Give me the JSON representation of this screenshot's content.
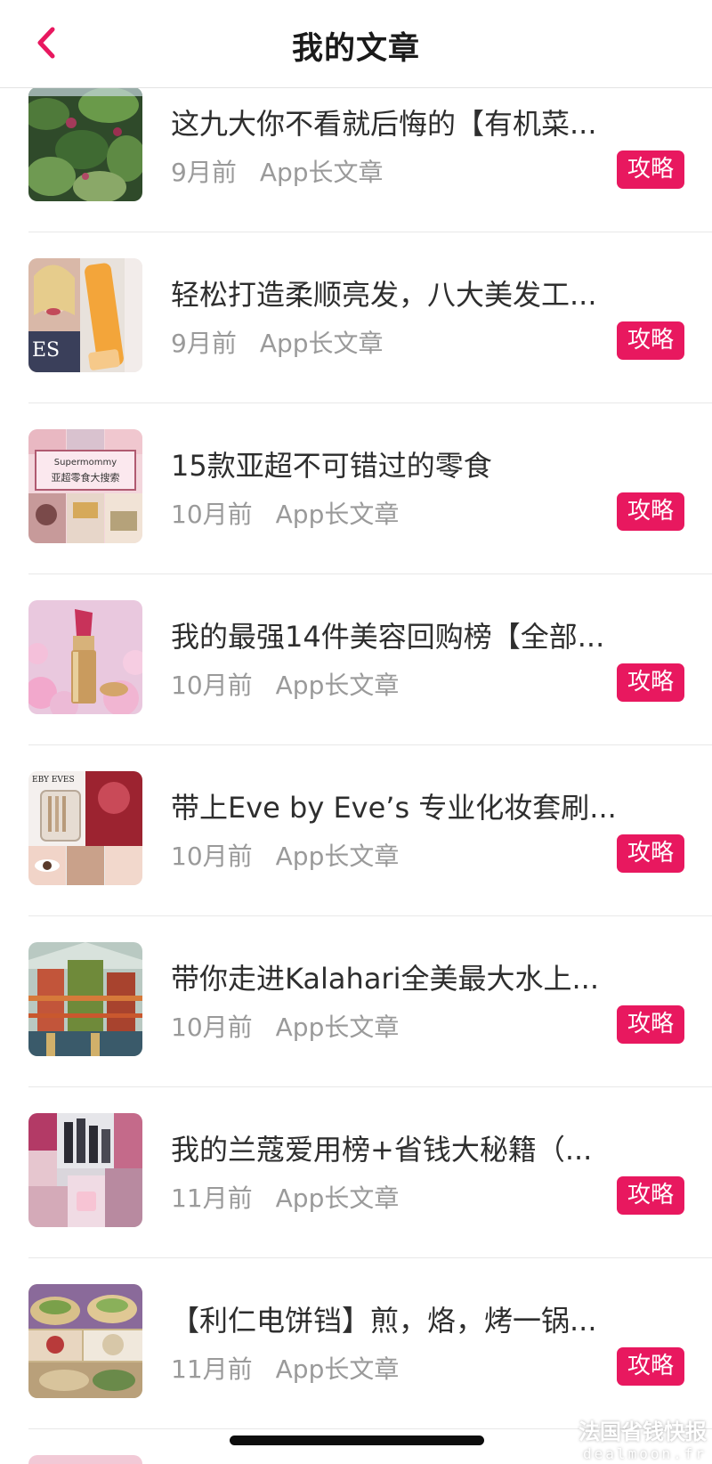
{
  "header": {
    "title": "我的文章",
    "back_icon": "chevron-left-icon",
    "accent": "#e8185f"
  },
  "articles": [
    {
      "title": "这九大你不看就后悔的【有机菜...",
      "time": "9月前",
      "source": "App长文章",
      "tag": "攻略",
      "thumb": "green-foliage"
    },
    {
      "title": "轻松打造柔顺亮发，八大美发工...",
      "time": "9月前",
      "source": "App长文章",
      "tag": "攻略",
      "thumb": "hair-product"
    },
    {
      "title": "15款亚超不可错过的零食",
      "time": "10月前",
      "source": "App长文章",
      "tag": "攻略",
      "thumb": "snacks-collage",
      "thumb_text": [
        "Supermommy",
        "亚超零食大搜索"
      ]
    },
    {
      "title": "我的最强14件美容回购榜【全部...",
      "time": "10月前",
      "source": "App长文章",
      "tag": "攻略",
      "thumb": "lipstick"
    },
    {
      "title": "带上Eve by  Eve’s 专业化妆套刷...",
      "time": "10月前",
      "source": "App长文章",
      "tag": "攻略",
      "thumb": "brush-set",
      "thumb_text": [
        "EBY EVES"
      ]
    },
    {
      "title": "带你走进Kalahari全美最大水上...",
      "time": "10月前",
      "source": "App长文章",
      "tag": "攻略",
      "thumb": "waterpark"
    },
    {
      "title": "我的兰蔻爱用榜+省钱大秘籍（...",
      "time": "11月前",
      "source": "App长文章",
      "tag": "攻略",
      "thumb": "lancome-collage"
    },
    {
      "title": "【利仁电饼铛】煎，烙，烤一锅...",
      "time": "11月前",
      "source": "App长文章",
      "tag": "攻略",
      "thumb": "food-collage"
    }
  ],
  "watermark": {
    "cn": "法国省钱快报",
    "en": "dealmoon.fr"
  }
}
